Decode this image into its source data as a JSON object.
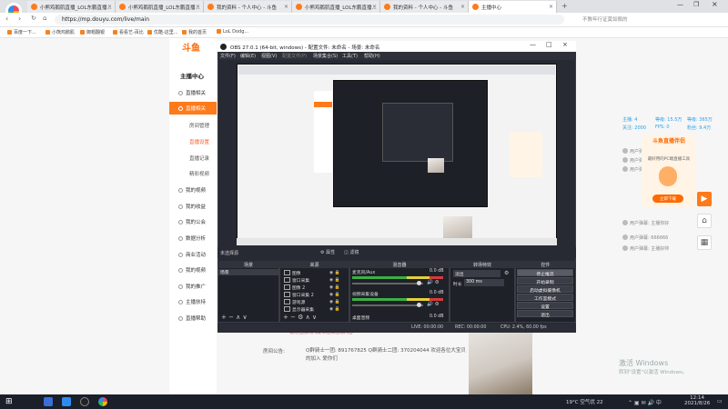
{
  "browser": {
    "tabs": [
      {
        "label": "小熊鸡鹅肌直播_LOL东鹏直播..."
      },
      {
        "label": "小熊鸡鹅肌直播_LOL东鹏直播..."
      },
      {
        "label": "我的资料 - 个人中心 - 斗鱼"
      },
      {
        "label": "小熊鸡鹅肌直播_LOL东鹏直播..."
      },
      {
        "label": "我的资料 - 个人中心 - 斗鱼"
      },
      {
        "label": "主播中心"
      }
    ],
    "url": "https://mp.douyu.com/live/main",
    "url_hint": "不教年行证莫如佩的",
    "bookmarks": [
      "百度一下...",
      "小熊鸡鹅肌",
      "御帽翻银",
      "看看艺-百比",
      "优酷-这里...",
      "我的首页",
      "LoL Dodg..."
    ]
  },
  "page": {
    "logo": "斗鱼",
    "sidebar_title": "主播中心",
    "sidebar": [
      {
        "label": "直播相关"
      },
      {
        "label": "直播相关"
      },
      {
        "label": "我的视频"
      },
      {
        "label": "我的收益"
      },
      {
        "label": "我的公会"
      },
      {
        "label": "数据分析"
      },
      {
        "label": "商业活动"
      },
      {
        "label": "我的视频"
      },
      {
        "label": "我的推广"
      },
      {
        "label": "主播扶持"
      },
      {
        "label": "直播帮助"
      }
    ],
    "sub_items": [
      {
        "label": "房间管理"
      },
      {
        "label": "直播设置"
      },
      {
        "label": "直播记录"
      },
      {
        "label": "精彩视频"
      }
    ],
    "notice_label": "房间公告:",
    "notice_text": "Q群骑士一团: 891767825 Q群骑士二团: 370204044 欢迎各位大宝贝的加入 爱你们",
    "red_note": "请勿在房间内发布违法违规内容",
    "helper": {
      "title": "斗鱼直播伴侣",
      "subtitle": "最好用的PC端直播工具",
      "button": "立即下载"
    },
    "stats": [
      "主播: 4",
      "等级: 15.5万",
      "等级: 365万",
      "关注: 2000",
      "FPS: 0",
      "粉丝: 9.4万"
    ],
    "chat": [
      "用户弹幕: 主播加油",
      "用户弹幕: 来了来了",
      "用户弹幕: 哈哈哈哈",
      "用户弹幕: 主播你好",
      "用户弹幕: 666666",
      "用户弹幕: 主播好帅"
    ],
    "watermark_title": "激活 Windows",
    "watermark_sub": "转到\"设置\"以激活 Windows。"
  },
  "obs": {
    "title": "OBS 27.0.1 (64-bit, windows) - 配置文件: 未命名 - 场景: 未命名",
    "menu": [
      "文件(F)",
      "编辑(E)",
      "视图(V)",
      "配置文件(P)",
      "场景集合(S)",
      "工具(T)",
      "帮助(H)"
    ],
    "status_mid": [
      "未选择源",
      "属性",
      "滤镜"
    ],
    "panels": {
      "scenes": "场景",
      "sources": "来源",
      "mixer": "混音器",
      "transitions": "转场特效",
      "controls": "控件"
    },
    "scene_item": "场景",
    "sources": [
      "图像",
      "窗口采集",
      "图像 2",
      "窗口采集 2",
      "游戏源",
      "显示器采集"
    ],
    "mixer": [
      {
        "name": "麦克风/Aux",
        "db": "0.0 dB"
      },
      {
        "name": "视频采集设备",
        "db": "0.0 dB"
      },
      {
        "name": "桌面音频",
        "db": "0.0 dB"
      }
    ],
    "transition": {
      "type": "淡出",
      "duration_label": "时长",
      "duration": "300 ms"
    },
    "controls": [
      "停止推流",
      "开始录制",
      "启动虚拟摄像机",
      "工作室模式",
      "设置",
      "退出"
    ],
    "status": {
      "live": "LIVE: 00:00:00",
      "rec": "REC: 00:00:00",
      "cpu": "CPU: 2.4%, 60.00 fps"
    }
  },
  "taskbar": {
    "weather": "19°C 空气优 22",
    "time": "12:14",
    "date": "2021/8/26"
  }
}
